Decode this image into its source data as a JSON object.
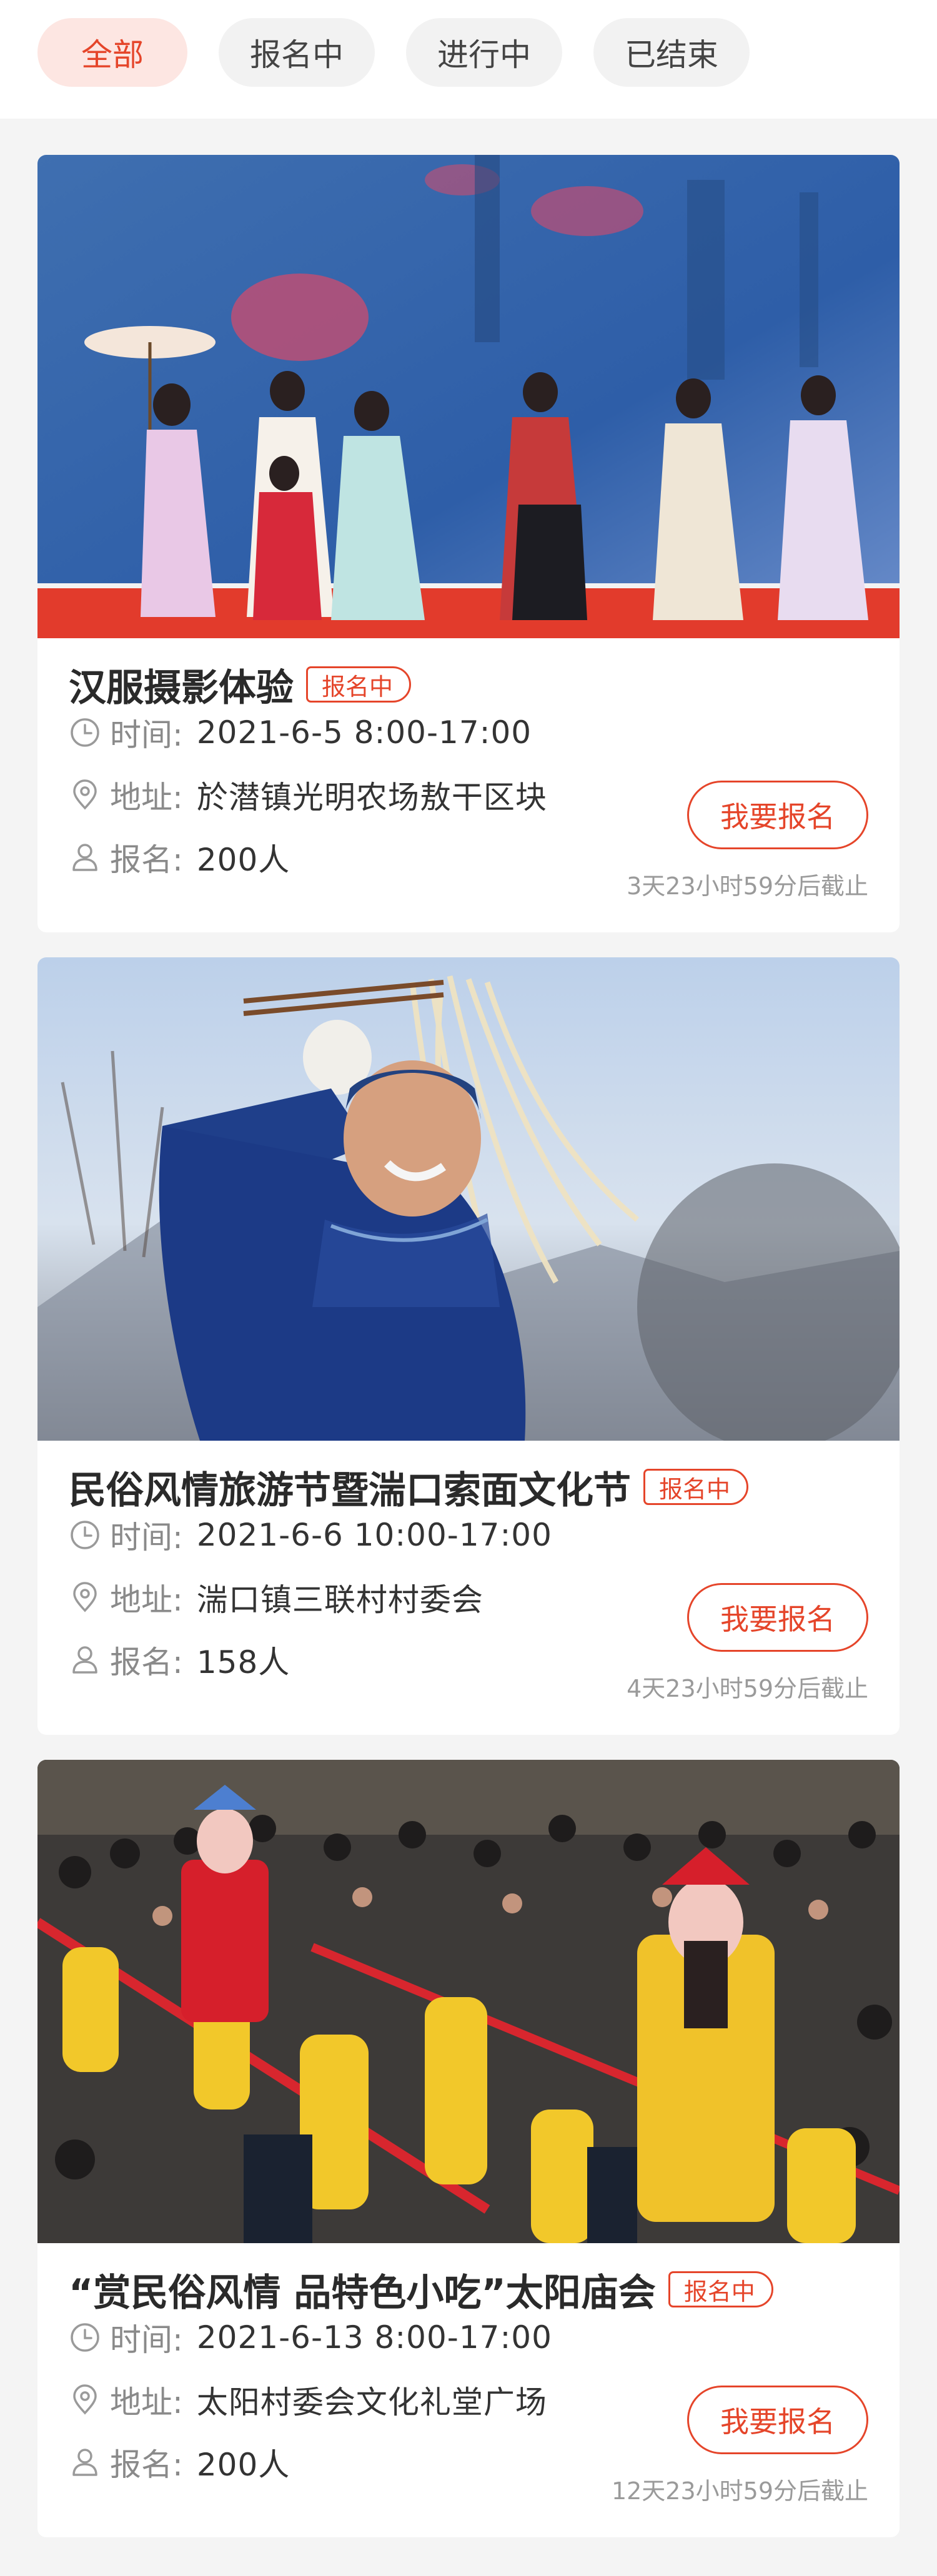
{
  "tabs": [
    {
      "label": "全部",
      "active": true
    },
    {
      "label": "报名中",
      "active": false
    },
    {
      "label": "进行中",
      "active": false
    },
    {
      "label": "已结束",
      "active": false
    }
  ],
  "labels": {
    "time": "时间:",
    "address": "地址:",
    "signup": "报名:"
  },
  "colors": {
    "accent": "#e5452a",
    "accent_bg": "#fde6e2"
  },
  "events": [
    {
      "title": "汉服摄影体验",
      "status": "报名中",
      "time": "2021-6-5   8:00-17:00",
      "address": "於潜镇光明农场敖干区块",
      "signup_count": "200人",
      "button": "我要报名",
      "deadline": "3天23小时59分后截止"
    },
    {
      "title": "民俗风情旅游节暨湍口索面文化节",
      "status": "报名中",
      "time": "2021-6-6   10:00-17:00",
      "address": "湍口镇三联村村委会",
      "signup_count": "158人",
      "button": "我要报名",
      "deadline": "4天23小时59分后截止"
    },
    {
      "title": "“赏民俗风情 品特色小吃”太阳庙会",
      "status": "报名中",
      "time": "2021-6-13   8:00-17:00",
      "address": "太阳村委会文化礼堂广场",
      "signup_count": "200人",
      "button": "我要报名",
      "deadline": "12天23小时59分后截止"
    }
  ]
}
